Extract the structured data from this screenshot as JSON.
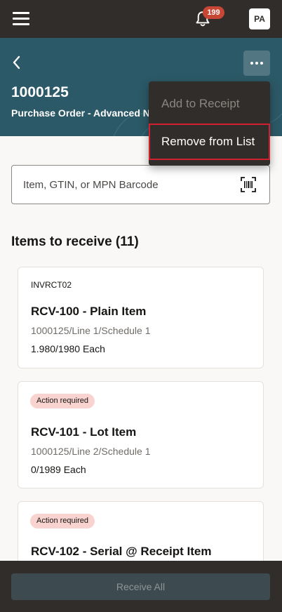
{
  "topbar": {
    "notification_count": "199",
    "avatar_initials": "PA"
  },
  "header": {
    "po_number": "1000125",
    "subtitle": "Purchase Order - Advanced N"
  },
  "menu": {
    "items": [
      {
        "label": "Add to Receipt",
        "enabled": false
      },
      {
        "label": "Remove from List",
        "enabled": true
      }
    ]
  },
  "search": {
    "placeholder": "Item, GTIN, or MPN Barcode"
  },
  "section": {
    "title": "Items to receive (11)"
  },
  "items": [
    {
      "code": "INVRCT02",
      "title": "RCV-100 - Plain Item",
      "line": "1000125/Line 1/Schedule 1",
      "qty": "1.980/1980 Each"
    },
    {
      "badge": "Action required",
      "title": "RCV-101 - Lot Item",
      "line": "1000125/Line 2/Schedule 1",
      "qty": "0/1989 Each"
    },
    {
      "badge": "Action required",
      "title": "RCV-102 - Serial @ Receipt Item"
    }
  ],
  "footer": {
    "receive_all_label": "Receive All"
  },
  "colors": {
    "topbar": "#312d2a",
    "header": "#2c5967",
    "badge": "#c74634",
    "action_pill": "#f8d3cf",
    "highlight_border": "#d3202f"
  }
}
